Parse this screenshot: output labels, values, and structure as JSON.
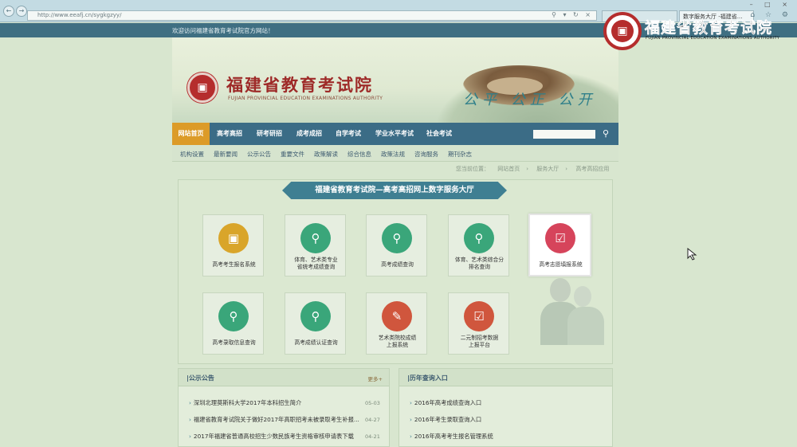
{
  "browser": {
    "url": "http://www.eeafj.cn/sygkgzyy/",
    "tab_active": "数字服务大厅 -福建省..."
  },
  "site": {
    "welcome": "欢迎访问福建省教育考试院官方网站！",
    "name": "福建省教育考试院",
    "name_en": "FUJIAN PROVINCIAL EDUCATION EXAMINATIONS AUTHORITY",
    "slogan": "公平 公正 公开"
  },
  "main_nav": [
    {
      "label": "网站首页",
      "active": true
    },
    {
      "label": "高考高招"
    },
    {
      "label": "研考研招"
    },
    {
      "label": "成考成招"
    },
    {
      "label": "自学考试"
    },
    {
      "label": "学业水平考试"
    },
    {
      "label": "社会考试"
    }
  ],
  "sub_nav": [
    "机构设置",
    "最新要闻",
    "公示公告",
    "重要文件",
    "政策解读",
    "综合信息",
    "政策法规",
    "咨询服务",
    "期刊杂志"
  ],
  "breadcrumb": {
    "prefix": "您当前位置：",
    "items": [
      "网站首页",
      "服务大厅",
      "高考高招应用"
    ]
  },
  "service_hall": {
    "title": "福建省教育考试院—高考高招网上数字服务大厅",
    "tiles": [
      {
        "line1": "高考考生报名系统",
        "line2": "",
        "color": "#d9a52a",
        "icon": "monitor-icon"
      },
      {
        "line1": "体育、艺术类专业",
        "line2": "省统考成绩查询",
        "color": "#3aa67a",
        "icon": "search-doc-icon"
      },
      {
        "line1": "高考成绩查询",
        "line2": "",
        "color": "#3aa67a",
        "icon": "search-doc-icon"
      },
      {
        "line1": "体育、艺术类综合分",
        "line2": "排名查询",
        "color": "#3aa67a",
        "icon": "search-doc-icon"
      },
      {
        "line1": "高考志愿填报系统",
        "line2": "",
        "color": "#d6445b",
        "icon": "checklist-icon"
      },
      {
        "line1": "高考录取信息查询",
        "line2": "",
        "color": "#3aa67a",
        "icon": "search-doc-icon"
      },
      {
        "line1": "高考成绩认证查询",
        "line2": "",
        "color": "#3aa67a",
        "icon": "search-doc-icon"
      },
      {
        "line1": "艺术类院校成绩",
        "line2": "上报系统",
        "color": "#d0563d",
        "icon": "edit-doc-icon"
      },
      {
        "line1": "二元制招考数据",
        "line2": "上报平台",
        "color": "#d0563d",
        "icon": "checklist-icon"
      }
    ]
  },
  "announcements": {
    "title": "公示公告",
    "more": "更多+",
    "items": [
      {
        "text": "深圳北理莫斯科大学2017年本科招生简介",
        "date": "05-03"
      },
      {
        "text": "福建省教育考试院关于做好2017年高职招考未被录取考生补报...",
        "date": "04-27"
      },
      {
        "text": "2017年福建省普通高校招生少数民族考生资格审核申请表下载",
        "date": "04-21"
      }
    ]
  },
  "history": {
    "title": "历年查询入口",
    "items": [
      "2016年高考成绩查询入口",
      "2016年考生录取查询入口",
      "2016年高考考生报名管理系统"
    ]
  },
  "watermark": {
    "name": "福建省教育考试院",
    "name_en": "FUJIAN PROVINCIAL EDUCATION EXAMINATIONS AUTHORITY"
  }
}
